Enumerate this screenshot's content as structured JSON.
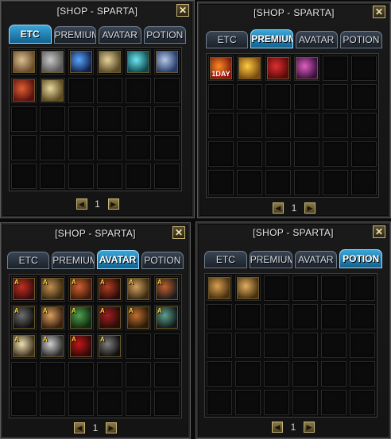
{
  "panels": [
    {
      "title": "[SHOP - SPARTA]",
      "close": "✕",
      "tabs": [
        "ETC",
        "PREMIUM",
        "AVATAR",
        "POTION"
      ],
      "active_tab": "ETC",
      "items": [
        {
          "name": "armor-bundle",
          "colors": [
            "#6b4a2a",
            "#d8c090"
          ]
        },
        {
          "name": "hammer",
          "colors": [
            "#555555",
            "#c8c8c8"
          ]
        },
        {
          "name": "blue-orb",
          "colors": [
            "#10204a",
            "#59a8ff"
          ]
        },
        {
          "name": "scroll",
          "colors": [
            "#5a4a2a",
            "#e6d39a"
          ]
        },
        {
          "name": "cyan-crystal",
          "colors": [
            "#0d4a50",
            "#6ee8f0"
          ]
        },
        {
          "name": "shield-crest",
          "colors": [
            "#233a6a",
            "#b8c8e8"
          ]
        },
        {
          "name": "red-banner",
          "colors": [
            "#5a1010",
            "#e06030"
          ]
        },
        {
          "name": "golden-tome",
          "colors": [
            "#5a4a20",
            "#e8d8a0"
          ]
        }
      ],
      "page": "1"
    },
    {
      "title": "[SHOP - SPARTA]",
      "close": "✕",
      "tabs": [
        "ETC",
        "PREMIUM",
        "AVATAR",
        "POTION"
      ],
      "active_tab": "PREMIUM",
      "items": [
        {
          "name": "premium-1day",
          "colors": [
            "#7a1a10",
            "#ff8a20"
          ],
          "label": "1DAY"
        },
        {
          "name": "golden-gauntlet",
          "colors": [
            "#7a4a10",
            "#ffcc40"
          ]
        },
        {
          "name": "red-card",
          "colors": [
            "#5a0a0a",
            "#e03030"
          ]
        },
        {
          "name": "pink-potion",
          "colors": [
            "#3a1040",
            "#e060c0"
          ]
        }
      ],
      "page": "1"
    },
    {
      "title": "[SHOP - SPARTA]",
      "close": "✕",
      "tabs": [
        "ETC",
        "PREMIUM",
        "AVATAR",
        "POTION"
      ],
      "active_tab": "AVATAR",
      "items": [
        {
          "name": "avatar-red-cape",
          "colors": [
            "#3a0c0c",
            "#c03020"
          ],
          "badge": "A"
        },
        {
          "name": "avatar-warrior-hood",
          "colors": [
            "#3a2a10",
            "#c09050"
          ],
          "badge": "A"
        },
        {
          "name": "avatar-spartan-shield",
          "colors": [
            "#401a0a",
            "#d06030"
          ],
          "badge": "A"
        },
        {
          "name": "avatar-red-armor",
          "colors": [
            "#2a0a0a",
            "#b04020"
          ],
          "badge": "A"
        },
        {
          "name": "avatar-spartan-helm",
          "colors": [
            "#3a2a10",
            "#d0a060"
          ],
          "badge": "A"
        },
        {
          "name": "avatar-round-shield",
          "colors": [
            "#1a1a1a",
            "#c06030"
          ],
          "badge": "A"
        },
        {
          "name": "avatar-dark-knight",
          "colors": [
            "#101010",
            "#707070"
          ],
          "badge": "A"
        },
        {
          "name": "avatar-bronze-mask",
          "colors": [
            "#3a2010",
            "#d8a060"
          ],
          "badge": "A"
        },
        {
          "name": "avatar-green-helm",
          "colors": [
            "#102a10",
            "#50a050"
          ],
          "badge": "A"
        },
        {
          "name": "avatar-crimson-plate",
          "colors": [
            "#2a0a0a",
            "#a02020"
          ],
          "badge": "A"
        },
        {
          "name": "avatar-war-chief",
          "colors": [
            "#2a1a0a",
            "#c07030"
          ],
          "badge": "A"
        },
        {
          "name": "avatar-scythe",
          "colors": [
            "#101a1a",
            "#60a090"
          ],
          "badge": "A"
        },
        {
          "name": "avatar-angel-wings",
          "colors": [
            "#3a3020",
            "#f0e0b0"
          ],
          "badge": "A"
        },
        {
          "name": "avatar-silver-wings",
          "colors": [
            "#2a2a2a",
            "#d0d0d0"
          ],
          "badge": "A"
        },
        {
          "name": "avatar-red-demon",
          "colors": [
            "#300808",
            "#c01818"
          ],
          "badge": "A"
        },
        {
          "name": "avatar-dark-wings",
          "colors": [
            "#101010",
            "#808080"
          ],
          "badge": "A"
        }
      ],
      "page": "1"
    },
    {
      "title": "[SHOP - SPARTA]",
      "close": "✕",
      "tabs": [
        "ETC",
        "PREMIUM",
        "AVATAR",
        "POTION"
      ],
      "active_tab": "POTION",
      "items": [
        {
          "name": "treasure-chest-small",
          "colors": [
            "#4a3010",
            "#d8a050"
          ]
        },
        {
          "name": "treasure-chest-large",
          "colors": [
            "#4a3010",
            "#e0b060"
          ]
        }
      ],
      "page": "1"
    }
  ]
}
